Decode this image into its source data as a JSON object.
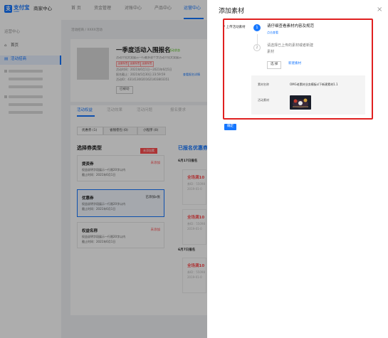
{
  "header": {
    "logo_mark": "支",
    "logo_text": "支付宝",
    "logo_sub": "ALIPAY",
    "center_title": "商家中心",
    "nav": [
      "首 页",
      "资金管理",
      "对账中心",
      "产品中心",
      "运营中心"
    ],
    "active_nav_index": 4
  },
  "sidebar": {
    "heading": "运营中心",
    "items": [
      {
        "icon": "home-icon",
        "glyph": "⌂",
        "label": "首页"
      },
      {
        "icon": "activity-icon",
        "glyph": "▤",
        "label": "活动招商"
      }
    ]
  },
  "breadcrumb": "活动招商 / XXXX活动",
  "activity": {
    "title": "一季度活动入围报名",
    "status": "活动状态",
    "desc": "活动介绍文案展示一行最多说个字活动介绍文案展示",
    "tags": [
      "运营标签",
      "运营标签",
      "运营标签"
    ],
    "time": "活动时间：2021年6月1日—2021年6月5日",
    "deadline": "报名截止：2021年5月30日 23:59:59",
    "detail_link": "查看报名详情",
    "id": "活动ID：43141300201621403803351",
    "button": "已被动"
  },
  "main_tabs": [
    "活动权益",
    "活动效果",
    "活动问题",
    "报名要求"
  ],
  "sub_tabs": [
    "优惠券 (1)",
    "省钱卷包 (0)",
    "小程序 (0)"
  ],
  "coupon_section": {
    "title": "选择券类型",
    "hint_badge": "未添加素",
    "items": [
      {
        "name": "提资券",
        "status": "未添加",
        "line1": "权益说明字段展示一行限20字以内",
        "line2": "截止时间：2021年6月1日",
        "selected": false
      },
      {
        "name": "优惠券",
        "status": "已添加x张",
        "line1": "权益说明字段展示一行限20字以内",
        "line2": "截止时间：2021年6月1日",
        "selected": true
      },
      {
        "name": "权益名称",
        "status": "未添加",
        "line1": "权益说明字段展示一行限20字以内",
        "line2": "截止时间：2021年6月1日",
        "selected": false
      }
    ]
  },
  "right_column": {
    "title": "已报名优惠券",
    "date1": "6月17日报名",
    "date2": "6月7日报名",
    "cards": [
      {
        "a": "全场满10",
        "b": "券ID：55098",
        "c": "2019-01-0"
      },
      {
        "a": "全场满10",
        "b": "券ID：55098",
        "c": "2019-01-0"
      },
      {
        "a": "全场满10",
        "b": "券ID：55098",
        "c": "2019-01-0"
      }
    ]
  },
  "drawer": {
    "title": "添加素材",
    "close": "×",
    "field_label": "* 上传活动素材",
    "step1_num": "1",
    "step1_title": "请仔细查看素材内容及规范",
    "step1_link": "点击查看",
    "step2_num": "2",
    "step2_title_line1": "请选择已上传的素材或者新建",
    "step2_title_line2": "素材",
    "choose_button": "选 择",
    "new_link": "新建素材",
    "material_name_label": "素材名称",
    "material_name_value": "OMG老素材业务模板s/下新建素材1.1",
    "material_label": "活动素材",
    "confirm_button": "确定",
    "colors": {
      "primary": "#1677ff",
      "highlight": "#e02020"
    }
  }
}
